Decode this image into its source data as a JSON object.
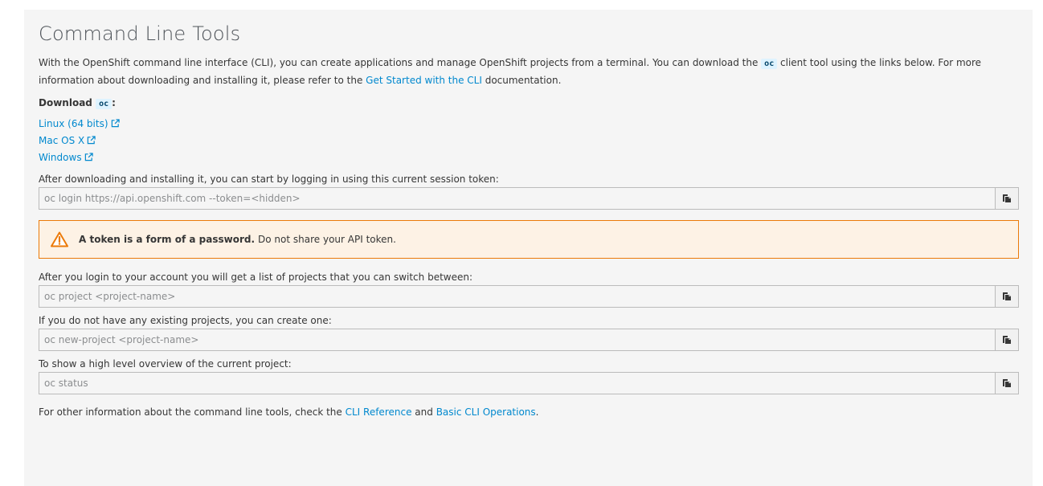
{
  "title": "Command Line Tools",
  "intro": {
    "part1": "With the OpenShift command line interface (CLI), you can create applications and manage OpenShift projects from a terminal. You can download the ",
    "code": "oc",
    "part2": " client tool using the links below. For more information about downloading and installing it, please refer to the ",
    "link": "Get Started with the CLI",
    "part3": " documentation."
  },
  "download": {
    "label": "Download",
    "code": "oc",
    "colon": ":",
    "links": [
      {
        "label": "Linux (64 bits)"
      },
      {
        "label": "Mac OS X"
      },
      {
        "label": "Windows"
      }
    ]
  },
  "commands": [
    {
      "label": "After downloading and installing it, you can start by logging in using this current session token:",
      "value": "oc login https://api.openshift.com --token=<hidden>"
    },
    {
      "label": "After you login to your account you will get a list of projects that you can switch between:",
      "value": "oc project <project-name>"
    },
    {
      "label": "If you do not have any existing projects, you can create one:",
      "value": "oc new-project <project-name>"
    },
    {
      "label": "To show a high level overview of the current project:",
      "value": "oc status"
    }
  ],
  "alert": {
    "bold": "A token is a form of a password.",
    "text": "Do not share your API token."
  },
  "footer": {
    "part1": "For other information about the command line tools, check the ",
    "link1": "CLI Reference",
    "part2": " and ",
    "link2": "Basic CLI Operations",
    "part3": "."
  },
  "icons": {
    "external": "external-link-icon",
    "copy": "copy-icon",
    "warning": "warning-triangle-icon"
  },
  "colors": {
    "link": "#0088ce",
    "warning": "#ec7a08",
    "alert_bg": "#fdf2e5",
    "panel_bg": "#f5f5f5"
  }
}
